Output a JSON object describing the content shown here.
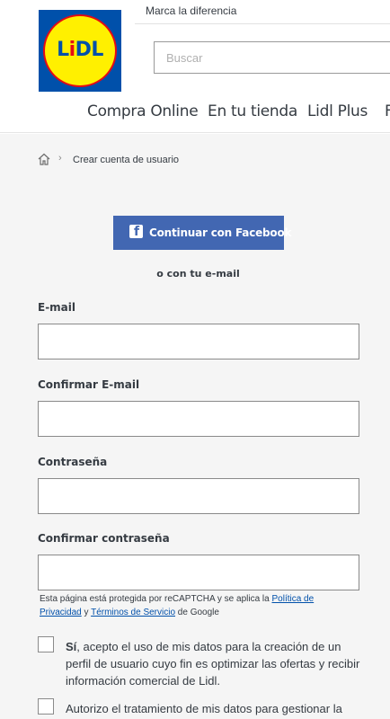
{
  "header": {
    "tagline": "Marca la diferencia",
    "logo_text": "LiDL",
    "search_placeholder": "Buscar",
    "nav": [
      {
        "label": "Compra Online"
      },
      {
        "label": "En tu tienda"
      },
      {
        "label": "Lidl Plus"
      },
      {
        "label": "F"
      }
    ]
  },
  "breadcrumb": {
    "home_icon": "home-icon",
    "separator": "›",
    "current": "Crear cuenta de usuario"
  },
  "signup": {
    "facebook_button": "Continuar con Facebook",
    "facebook_icon": "f",
    "or_email": "o con tu e-mail",
    "fields": [
      {
        "label": "E-mail",
        "value": ""
      },
      {
        "label": "Confirmar E-mail",
        "value": ""
      },
      {
        "label": "Contraseña",
        "value": ""
      },
      {
        "label": "Confirmar contraseña",
        "value": ""
      }
    ],
    "recaptcha": {
      "prefix": "Esta página está protegida por reCAPTCHA y se aplica la ",
      "privacy_link": "Política de Privacidad",
      "middle": " y ",
      "terms_link": "Términos de Servicio",
      "suffix": " de Google"
    },
    "consent_1": {
      "bold": "Sí",
      "text": ", acepto el uso de mis datos para la creación de un perfil de usuario cuyo fin es optimizar las ofertas y recibir información comercial de Lidl."
    },
    "consent_2": {
      "text": "Autorizo el tratamiento de mis datos para gestionar la"
    }
  },
  "colors": {
    "brand_blue": "#0050aa",
    "brand_yellow": "#fff000",
    "brand_red": "#e60a14",
    "facebook_blue": "#4267b2"
  }
}
